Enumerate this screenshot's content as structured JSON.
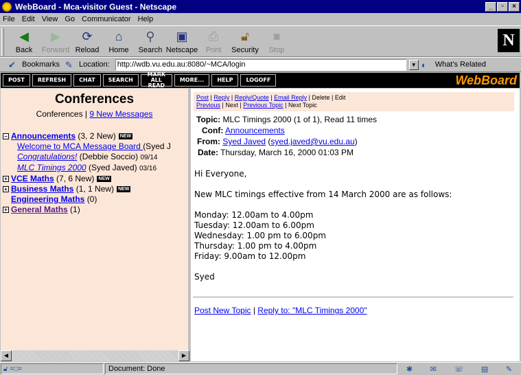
{
  "window": {
    "title": "WebBoard - Mca-visitor Guest - Netscape"
  },
  "menu": [
    "File",
    "Edit",
    "View",
    "Go",
    "Communicator",
    "Help"
  ],
  "toolbar": {
    "buttons": [
      {
        "label": "Back",
        "icon": "back-arrow-icon"
      },
      {
        "label": "Forward",
        "icon": "forward-arrow-icon"
      },
      {
        "label": "Reload",
        "icon": "reload-icon"
      },
      {
        "label": "Home",
        "icon": "home-icon"
      },
      {
        "label": "Search",
        "icon": "search-icon"
      },
      {
        "label": "Netscape",
        "icon": "netscape-icon"
      },
      {
        "label": "Print",
        "icon": "print-icon"
      },
      {
        "label": "Security",
        "icon": "lock-icon"
      },
      {
        "label": "Stop",
        "icon": "stop-icon"
      }
    ]
  },
  "location": {
    "bookmarks_label": "Bookmarks",
    "location_label": "Location:",
    "url": "http://wdb.vu.edu.au:8080/~MCA/login",
    "related_label": "What's Related"
  },
  "webboard_nav": {
    "buttons": [
      "POST",
      "REFRESH",
      "CHAT",
      "SEARCH",
      "MARK ALL READ",
      "MORE...",
      "HELP",
      "LOGOFF"
    ],
    "logo": "WebBoard"
  },
  "sidebar": {
    "title": "Conferences",
    "subtitle_prefix": "Conferences | ",
    "new_messages_link": "9 New Messages",
    "new_badge": "NEW",
    "conferences": [
      {
        "name": "Announcements",
        "count": "(3, 2 New)",
        "expanded": true,
        "is_new": true,
        "topics": [
          {
            "title": "Welcome to MCA Message Board ",
            "author": "(Syed J",
            "date": ""
          },
          {
            "title": "Congratulations!",
            "author": " (Debbie Soccio) ",
            "date": "09/14"
          },
          {
            "title": "MLC Timings 2000",
            "author": " (Syed Javed) ",
            "date": "03/16"
          }
        ]
      },
      {
        "name": "VCE Maths",
        "count": "(7, 6 New)",
        "is_new": true
      },
      {
        "name": "Business Maths",
        "count": "(1, 1 New)",
        "is_new": true
      },
      {
        "name": "Engineering Maths",
        "count": "(0)"
      },
      {
        "name": "General Maths",
        "count": "(1)"
      }
    ]
  },
  "message": {
    "actions_row1": {
      "post": "Post",
      "reply": "Reply",
      "reply_quote": "Reply/Quote",
      "email_reply": "Email Reply",
      "delete": "Delete",
      "edit": "Edit"
    },
    "actions_row2": {
      "previous": "Previous",
      "next": "Next",
      "previous_topic": "Previous Topic",
      "next_topic": "Next Topic"
    },
    "topic_label": "Topic:",
    "topic_value": "MLC Timings 2000 (1 of 1), Read 11 times",
    "conf_label": "Conf:",
    "conf_value": "Announcements",
    "from_label": "From:",
    "from_name": "Syed Javed",
    "from_email": "syed.javed@vu.edu.au",
    "date_label": "Date:",
    "date_value": "Thursday, March 16, 2000 01:03 PM",
    "body": {
      "greeting": "Hi Everyone,",
      "intro": "New MLC timings effective from 14 March 2000 are as follows:",
      "schedule": [
        "Monday: 12.00am to 4.00pm",
        "Tuesday: 12.00am to 6.00pm",
        "Wednesday: 1.00 pm to 6.00pm",
        "Thursday: 1.00 pm to 4.00pm",
        "Friday: 9.00am to 12.00pm"
      ],
      "signature": "Syed"
    },
    "footer": {
      "post_new": "Post New Topic",
      "reply_to": "Reply to: \"MLC Timings 2000\""
    }
  },
  "status": {
    "text": "Document: Done"
  }
}
